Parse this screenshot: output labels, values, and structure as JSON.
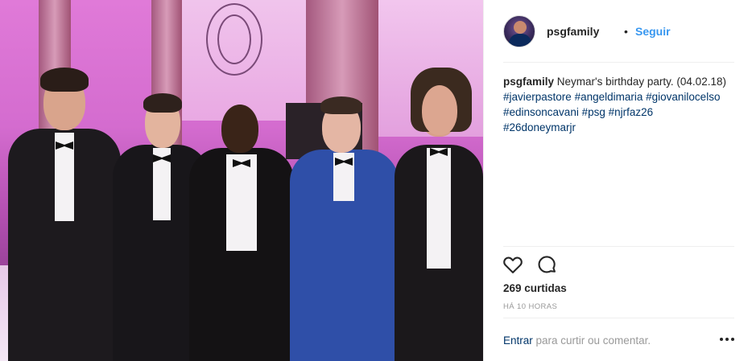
{
  "post": {
    "username": "psgfamily",
    "separator": "•",
    "follow_label": "Seguir",
    "caption_text": "Neymar's birthday party. (04.02.18)",
    "hashtags": [
      "#javierpastore",
      "#angeldimaria",
      "#giovanilocelso",
      "#edinsoncavani",
      "#psg",
      "#njrfaz26",
      "#26doneymarjr"
    ],
    "likes": "269 curtidas",
    "time": "HÁ 10 HORAS",
    "login_link": "Entrar",
    "login_rest": " para curtir ou comentar.",
    "more_label": "•••"
  },
  "icons": {
    "like": "heart-icon",
    "comment": "comment-icon",
    "more": "more-options-icon"
  },
  "colors": {
    "link_blue": "#3897f0",
    "hashtag": "#003569",
    "muted": "#999999",
    "photo_pink": "#d46ccf"
  }
}
